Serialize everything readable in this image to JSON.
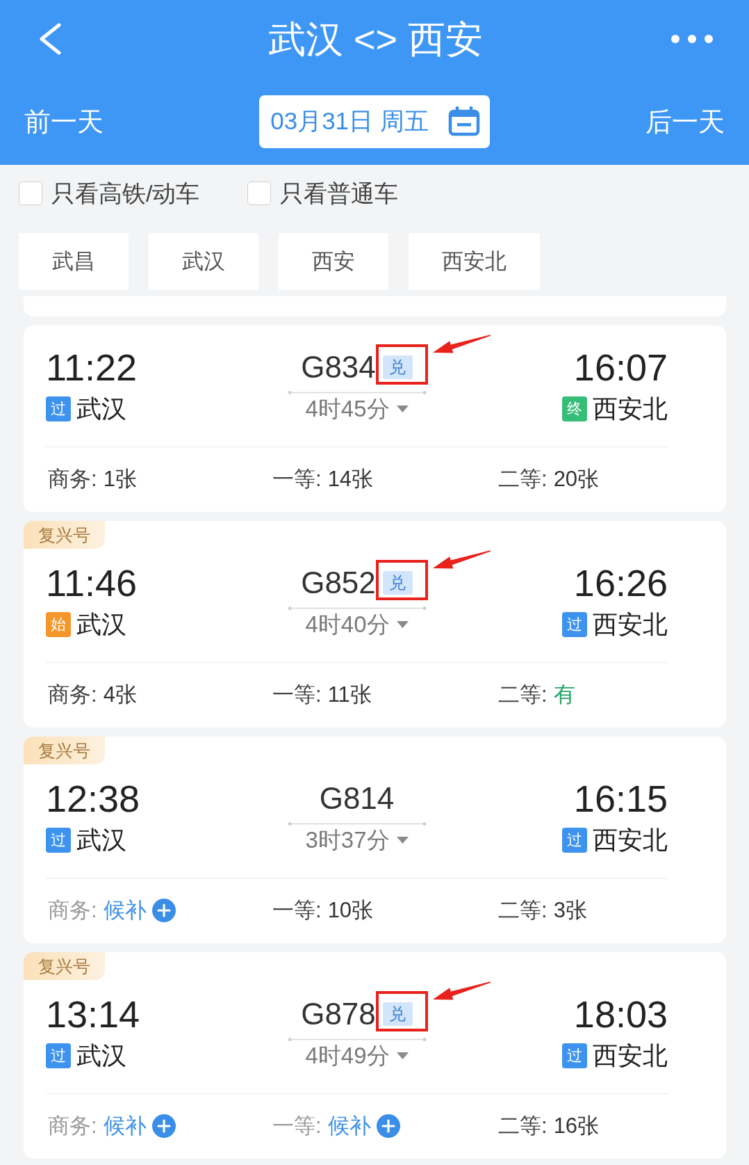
{
  "header": {
    "title": "武汉 <> 西安",
    "previous_day": "前一天",
    "date": "03月31日 周五",
    "next_day": "后一天"
  },
  "filters": [
    {
      "label": "只看高铁/动车",
      "checked": false
    },
    {
      "label": "只看普通车",
      "checked": false
    }
  ],
  "stations": [
    {
      "label": "武昌",
      "selected": false
    },
    {
      "label": "武汉",
      "selected": false
    },
    {
      "label": "西安",
      "selected": false
    },
    {
      "label": "西安北",
      "selected": false
    }
  ],
  "trains": [
    {
      "departure_time": "11:22",
      "departure_station": {
        "badge": "过",
        "kind": "pass",
        "name": "武汉"
      },
      "train_number": "G834",
      "exchange_badge": {
        "label": "兑",
        "highlighted": true
      },
      "duration": "4时45分",
      "arrival_time": "16:07",
      "arrival_station": {
        "badge": "终",
        "kind": "terminal",
        "name": "西安北"
      },
      "seats": [
        {
          "label": "商务:",
          "value": "1张",
          "kind": "count"
        },
        {
          "label": "一等:",
          "value": "14张",
          "kind": "count"
        },
        {
          "label": "二等:",
          "value": "20张",
          "kind": "count"
        }
      ]
    },
    {
      "tag": "复兴号",
      "departure_time": "11:46",
      "departure_station": {
        "badge": "始",
        "kind": "origin",
        "name": "武汉"
      },
      "train_number": "G852",
      "exchange_badge": {
        "label": "兑",
        "highlighted": true
      },
      "duration": "4时40分",
      "arrival_time": "16:26",
      "arrival_station": {
        "badge": "过",
        "kind": "pass",
        "name": "西安北"
      },
      "seats": [
        {
          "label": "商务:",
          "value": "4张",
          "kind": "count"
        },
        {
          "label": "一等:",
          "value": "11张",
          "kind": "count"
        },
        {
          "label": "二等:",
          "value": "有",
          "kind": "plenty"
        }
      ]
    },
    {
      "tag": "复兴号",
      "departure_time": "12:38",
      "departure_station": {
        "badge": "过",
        "kind": "pass",
        "name": "武汉"
      },
      "train_number": "G814",
      "duration": "3时37分",
      "arrival_time": "16:15",
      "arrival_station": {
        "badge": "过",
        "kind": "pass",
        "name": "西安北"
      },
      "seats": [
        {
          "label": "商务:",
          "value": "候补",
          "kind": "waitlist"
        },
        {
          "label": "一等:",
          "value": "10张",
          "kind": "count"
        },
        {
          "label": "二等:",
          "value": "3张",
          "kind": "count"
        }
      ]
    },
    {
      "tag": "复兴号",
      "departure_time": "13:14",
      "departure_station": {
        "badge": "过",
        "kind": "pass",
        "name": "武汉"
      },
      "train_number": "G878",
      "exchange_badge": {
        "label": "兑",
        "highlighted": true
      },
      "duration": "4时49分",
      "arrival_time": "18:03",
      "arrival_station": {
        "badge": "过",
        "kind": "pass",
        "name": "西安北"
      },
      "seats": [
        {
          "label": "商务:",
          "value": "候补",
          "kind": "waitlist"
        },
        {
          "label": "一等:",
          "value": "候补",
          "kind": "waitlist"
        },
        {
          "label": "二等:",
          "value": "16张",
          "kind": "count"
        }
      ]
    }
  ]
}
